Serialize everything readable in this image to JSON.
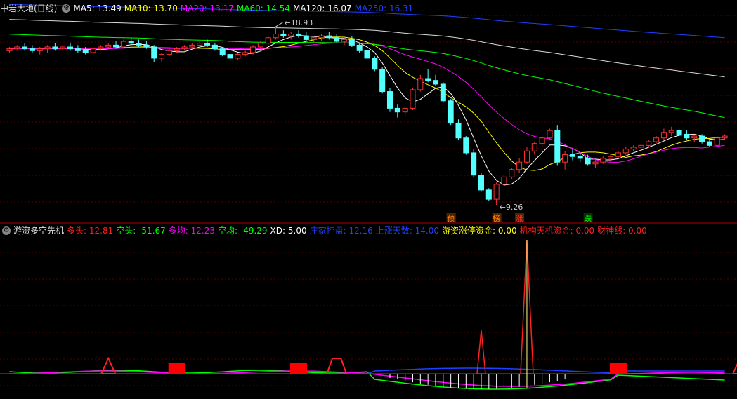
{
  "upper_legend": {
    "title": "中岩大地(日线)",
    "items": [
      {
        "label": "MA5: 13.49",
        "color": "#ffffff"
      },
      {
        "label": "MA10: 13.70",
        "color": "#ffff00"
      },
      {
        "label": "MA20: 13.17",
        "color": "#ff00ff"
      },
      {
        "label": "MA60: 14.54",
        "color": "#00ff00"
      },
      {
        "label": "MA120: 16.07",
        "color": "#ffffff"
      },
      {
        "label": "MA250: 16.31",
        "color": "#0000ff"
      }
    ]
  },
  "lower_legend": {
    "title": "游资多空先机",
    "items": [
      {
        "label": "多头: 12.81",
        "color": "#ff2020"
      },
      {
        "label": "空头: -51.67",
        "color": "#00ff00"
      },
      {
        "label": "多均: 12.23",
        "color": "#ff00ff"
      },
      {
        "label": "空均: -49.29",
        "color": "#00ff00"
      },
      {
        "label": "XD: 5.00",
        "color": "#ffffff"
      },
      {
        "label": "庄家控盘: 12.16",
        "color": "#2040ff"
      },
      {
        "label": "上涨天数: 14.00",
        "color": "#2040ff"
      },
      {
        "label": "游资涨停资金: 0.00",
        "color": "#ffff00"
      },
      {
        "label": "机构天机资金: 0.00",
        "color": "#ff2020"
      },
      {
        "label": "财神线: 0.00",
        "color": "#ff2020"
      }
    ]
  },
  "annotations": {
    "high_label": "18.93",
    "low_label": "9.26",
    "signal_yu": "预",
    "signal_bang": "榜",
    "signal_zhang": "涨",
    "signal_die": "跌"
  },
  "colors": {
    "up": "#ff3030",
    "down": "#54ffff",
    "grid": "#5a0000",
    "separator": "#b00000"
  },
  "chart_data": {
    "type": "candlestick",
    "high_marker": 18.93,
    "low_marker": 9.26,
    "ylim": [
      9.0,
      19.5
    ],
    "candles": [
      [
        17.6,
        17.8,
        17.5,
        17.7
      ],
      [
        17.7,
        17.9,
        17.6,
        17.8
      ],
      [
        17.8,
        18.0,
        17.6,
        17.7
      ],
      [
        17.7,
        17.9,
        17.5,
        17.6
      ],
      [
        17.6,
        17.8,
        17.4,
        17.7
      ],
      [
        17.7,
        17.9,
        17.5,
        17.8
      ],
      [
        17.8,
        18.0,
        17.6,
        17.7
      ],
      [
        17.7,
        17.9,
        17.6,
        17.8
      ],
      [
        17.8,
        18.0,
        17.6,
        17.7
      ],
      [
        17.7,
        17.9,
        17.5,
        17.6
      ],
      [
        17.6,
        17.8,
        17.4,
        17.5
      ],
      [
        17.5,
        17.8,
        17.3,
        17.7
      ],
      [
        17.7,
        17.9,
        17.6,
        17.8
      ],
      [
        17.8,
        18.0,
        17.7,
        17.9
      ],
      [
        17.9,
        18.1,
        17.7,
        17.8
      ],
      [
        17.8,
        18.2,
        17.7,
        18.1
      ],
      [
        18.1,
        18.3,
        17.9,
        18.0
      ],
      [
        18.0,
        18.2,
        17.8,
        17.9
      ],
      [
        17.9,
        18.1,
        17.7,
        17.8
      ],
      [
        17.8,
        17.9,
        17.0,
        17.2
      ],
      [
        17.2,
        17.5,
        17.0,
        17.4
      ],
      [
        17.4,
        17.7,
        17.3,
        17.6
      ],
      [
        17.6,
        17.8,
        17.5,
        17.7
      ],
      [
        17.7,
        17.9,
        17.6,
        17.8
      ],
      [
        17.8,
        18.0,
        17.7,
        17.9
      ],
      [
        17.9,
        18.1,
        17.8,
        18.0
      ],
      [
        18.0,
        18.2,
        17.8,
        17.9
      ],
      [
        17.9,
        18.0,
        17.6,
        17.7
      ],
      [
        17.7,
        17.8,
        17.3,
        17.4
      ],
      [
        17.4,
        17.5,
        17.0,
        17.2
      ],
      [
        17.2,
        17.5,
        17.1,
        17.4
      ],
      [
        17.4,
        17.6,
        17.3,
        17.5
      ],
      [
        17.5,
        17.9,
        17.4,
        17.8
      ],
      [
        17.8,
        18.1,
        17.7,
        18.0
      ],
      [
        18.0,
        18.4,
        17.9,
        18.3
      ],
      [
        18.3,
        18.9,
        18.2,
        18.5
      ],
      [
        18.5,
        18.7,
        18.3,
        18.4
      ],
      [
        18.4,
        18.6,
        18.2,
        18.5
      ],
      [
        18.5,
        18.7,
        18.3,
        18.4
      ],
      [
        18.4,
        18.6,
        18.1,
        18.2
      ],
      [
        18.2,
        18.4,
        18.0,
        18.3
      ],
      [
        18.3,
        18.5,
        18.1,
        18.4
      ],
      [
        18.4,
        18.6,
        18.2,
        18.3
      ],
      [
        18.3,
        18.5,
        18.0,
        18.1
      ],
      [
        18.1,
        18.3,
        17.9,
        18.2
      ],
      [
        18.2,
        18.4,
        17.8,
        17.9
      ],
      [
        17.9,
        18.0,
        17.5,
        17.6
      ],
      [
        17.6,
        17.7,
        17.1,
        17.2
      ],
      [
        17.2,
        17.3,
        16.5,
        16.6
      ],
      [
        16.6,
        16.7,
        15.3,
        15.4
      ],
      [
        15.4,
        15.6,
        14.3,
        14.5
      ],
      [
        14.5,
        14.7,
        14.0,
        14.3
      ],
      [
        14.3,
        14.6,
        14.1,
        14.5
      ],
      [
        14.5,
        15.6,
        14.4,
        15.5
      ],
      [
        15.5,
        16.3,
        15.4,
        16.1
      ],
      [
        16.1,
        16.6,
        15.9,
        16.0
      ],
      [
        16.0,
        16.3,
        15.7,
        15.8
      ],
      [
        15.8,
        15.9,
        14.8,
        14.9
      ],
      [
        14.9,
        15.0,
        13.6,
        13.7
      ],
      [
        13.7,
        13.9,
        12.8,
        12.9
      ],
      [
        12.9,
        13.0,
        12.0,
        12.1
      ],
      [
        12.1,
        12.3,
        10.8,
        10.9
      ],
      [
        10.9,
        11.0,
        10.0,
        10.1
      ],
      [
        10.1,
        10.2,
        9.5,
        9.6
      ],
      [
        9.6,
        10.5,
        9.26,
        10.4
      ],
      [
        10.4,
        10.9,
        10.3,
        10.8
      ],
      [
        10.8,
        11.3,
        10.7,
        11.2
      ],
      [
        11.2,
        11.8,
        11.0,
        11.6
      ],
      [
        11.6,
        12.4,
        11.5,
        12.2
      ],
      [
        12.2,
        12.7,
        12.0,
        12.6
      ],
      [
        12.6,
        13.0,
        12.4,
        12.9
      ],
      [
        12.9,
        13.4,
        12.8,
        13.3
      ],
      [
        13.3,
        13.6,
        11.4,
        11.6
      ],
      [
        11.6,
        12.2,
        11.2,
        12.0
      ],
      [
        12.0,
        12.3,
        11.7,
        11.9
      ],
      [
        11.9,
        12.1,
        11.6,
        11.8
      ],
      [
        11.8,
        12.0,
        11.4,
        11.5
      ],
      [
        11.5,
        11.7,
        11.3,
        11.6
      ],
      [
        11.6,
        11.9,
        11.5,
        11.8
      ],
      [
        11.8,
        12.0,
        11.6,
        11.9
      ],
      [
        11.9,
        12.2,
        11.8,
        12.1
      ],
      [
        12.1,
        12.4,
        12.0,
        12.3
      ],
      [
        12.3,
        12.5,
        12.2,
        12.4
      ],
      [
        12.4,
        12.6,
        12.2,
        12.5
      ],
      [
        12.5,
        12.8,
        12.4,
        12.7
      ],
      [
        12.7,
        13.0,
        12.6,
        12.9
      ],
      [
        12.9,
        13.4,
        12.8,
        13.2
      ],
      [
        13.2,
        13.5,
        13.0,
        13.3
      ],
      [
        13.3,
        13.4,
        13.0,
        13.1
      ],
      [
        13.1,
        13.3,
        12.8,
        12.9
      ],
      [
        12.9,
        13.1,
        12.7,
        13.0
      ],
      [
        13.0,
        13.1,
        12.6,
        12.7
      ],
      [
        12.7,
        12.8,
        12.4,
        12.5
      ],
      [
        12.5,
        13.0,
        12.4,
        12.9
      ],
      [
        12.9,
        13.1,
        12.8,
        13.0
      ]
    ],
    "signals": [
      {
        "text_key": "signal_yu",
        "index": 58,
        "color": "#ff8c00"
      },
      {
        "text_key": "signal_bang",
        "index": 64,
        "color": "#ff8c00"
      },
      {
        "text_key": "signal_zhang",
        "index": 67,
        "color": "#ff3030"
      },
      {
        "text_key": "signal_die",
        "index": 76,
        "color": "#00ff00"
      }
    ]
  }
}
